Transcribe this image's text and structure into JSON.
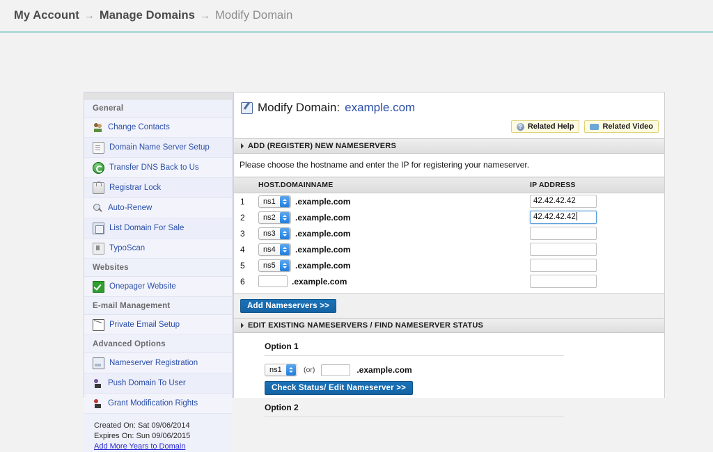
{
  "breadcrumb": {
    "items": [
      {
        "label": "My Account",
        "style": "bold"
      },
      {
        "label": "Manage Domains",
        "style": "bold"
      },
      {
        "label": "Modify Domain",
        "style": "current"
      }
    ],
    "separator": "→"
  },
  "sidebar": {
    "sections": [
      {
        "title": "General",
        "items": [
          {
            "label": "Change Contacts",
            "icon": "people-icon"
          },
          {
            "label": "Domain Name Server Setup",
            "icon": "document-icon"
          },
          {
            "label": "Transfer DNS Back to Us",
            "icon": "refresh-circle-icon"
          },
          {
            "label": "Registrar Lock",
            "icon": "lock-icon"
          },
          {
            "label": "Auto-Renew",
            "icon": "magnifier-icon"
          },
          {
            "label": "List Domain For Sale",
            "icon": "copy-icon"
          },
          {
            "label": "TypoScan",
            "icon": "box-icon"
          }
        ]
      },
      {
        "title": "Websites",
        "items": [
          {
            "label": "Onepager Website",
            "icon": "green-check-icon"
          }
        ]
      },
      {
        "title": "E-mail Management",
        "items": [
          {
            "label": "Private Email Setup",
            "icon": "mail-icon"
          }
        ]
      },
      {
        "title": "Advanced Options",
        "items": [
          {
            "label": "Nameserver Registration",
            "icon": "server-icon"
          },
          {
            "label": "Push Domain To User",
            "icon": "push-user-icon"
          },
          {
            "label": "Grant Modification Rights",
            "icon": "grant-user-icon"
          }
        ]
      }
    ],
    "footer": {
      "created": "Created On: Sat 09/06/2014",
      "expires": "Expires On: Sun 09/06/2015",
      "link": "Add More Years to Domain"
    }
  },
  "main": {
    "title_prefix": "Modify Domain:",
    "title_domain": "example.com",
    "help_button": "Related Help",
    "video_button": "Related Video",
    "section_add": "ADD (REGISTER) NEW NAMESERVERS",
    "intro": "Please choose the hostname and enter the IP for registering your nameserver.",
    "table": {
      "headers": {
        "host": "HOST.DOMAINNAME",
        "ip": "IP ADDRESS"
      },
      "domain_suffix": ".example.com",
      "ip_placeholder": "",
      "rows": [
        {
          "num": "1",
          "host": "ns1",
          "type": "select",
          "ip": "42.42.42.42",
          "focused": false
        },
        {
          "num": "2",
          "host": "ns2",
          "type": "select",
          "ip": "42.42.42.42",
          "focused": true
        },
        {
          "num": "3",
          "host": "ns3",
          "type": "select",
          "ip": "",
          "focused": false
        },
        {
          "num": "4",
          "host": "ns4",
          "type": "select",
          "ip": "",
          "focused": false
        },
        {
          "num": "5",
          "host": "ns5",
          "type": "select",
          "ip": "",
          "focused": false
        },
        {
          "num": "6",
          "host": "",
          "type": "text",
          "ip": "",
          "focused": false
        }
      ]
    },
    "add_button": "Add Nameservers >>",
    "section_edit": "EDIT EXISTING NAMESERVERS / FIND NAMESERVER STATUS",
    "option1": {
      "title": "Option 1",
      "select_value": "ns1",
      "or_label": "(or)",
      "text_value": "",
      "suffix": ".example.com",
      "button": "Check Status/ Edit Nameserver >>"
    },
    "option2": {
      "title": "Option 2"
    }
  },
  "colors": {
    "accent_blue": "#1a72b8",
    "link_blue": "#2b4fa8",
    "help_yellow": "#fdfbe0",
    "rule_teal": "#9fd3d3",
    "focus_blue": "#5b9ddb"
  }
}
